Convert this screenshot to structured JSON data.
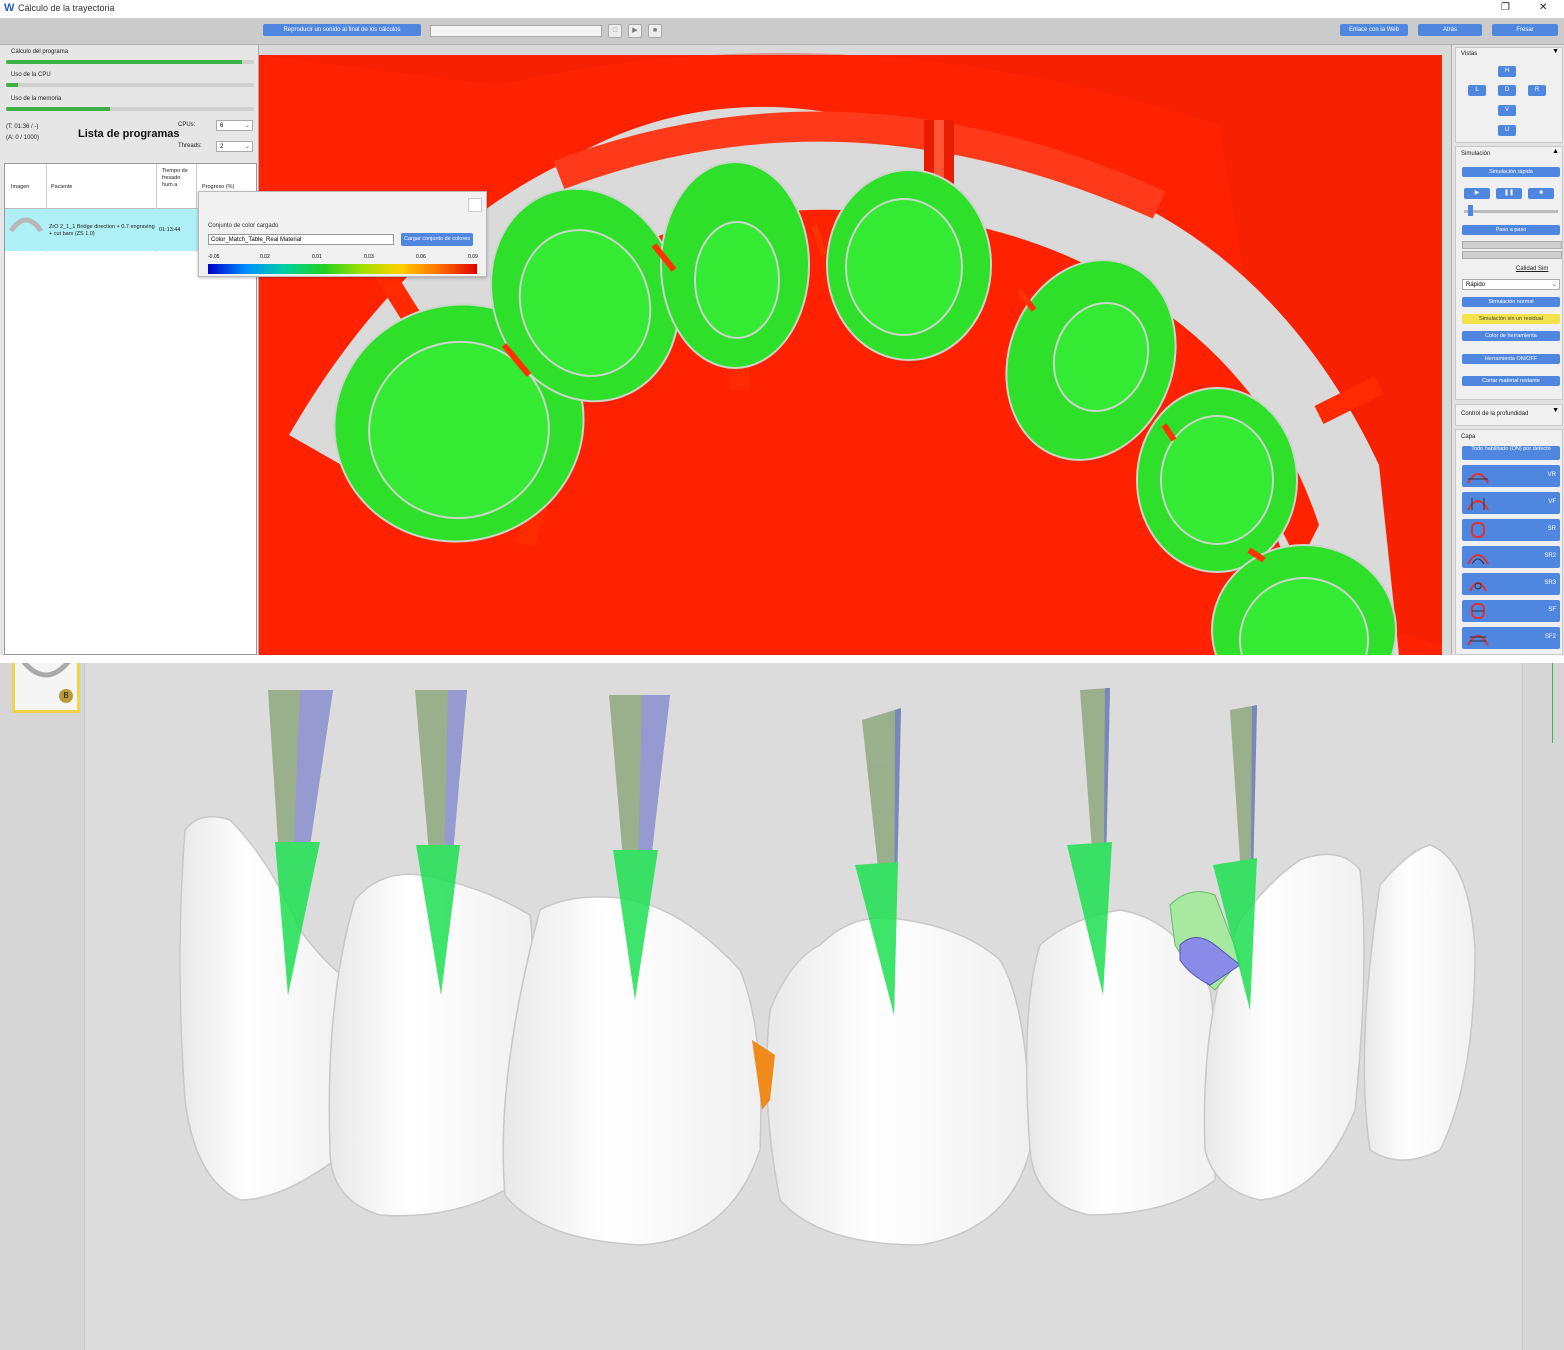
{
  "window": {
    "logo": "W",
    "title": "Cálculo de la trayectoria",
    "restore_icon": "restore-icon",
    "close_icon": "close-icon"
  },
  "toolbar": {
    "sound_button": "Reproducir un sonido al final de los cálculos",
    "web_link": "Enlace con la Web",
    "back": "Atrás",
    "mill": "Fresar"
  },
  "left": {
    "program_calc_label": "Cálculo del programa",
    "cpu_usage_label": "Uso de la CPU",
    "memory_usage_label": "Uso de la memoria",
    "progress_program": 0.95,
    "progress_cpu": 0.05,
    "progress_memory": 0.42,
    "time_info": "(T: 01:36 / -)",
    "count_info": "(A: 0 / 1000)",
    "list_title": "Lista de programas",
    "cpus_label": "CPUs:",
    "cpus_value": "6",
    "threads_label": "Threads:",
    "threads_value": "2",
    "table": {
      "headers": [
        "Imagen",
        "Paciente",
        "Tiempo de fresado hum.a",
        "Progreso (%)"
      ],
      "rows": [
        {
          "patient": "ZrO 2_1_1 Bridge direction + 0.7 engraving + cut bars (ZS 1.0)",
          "time": "01:13:44"
        }
      ]
    }
  },
  "popup": {
    "label": "Conjunto de color cargado",
    "value": "Color_Match_Table_Real Material",
    "load_button": "Cargar conjunto de colores",
    "scale_ticks": [
      "-0.05",
      "0.02",
      "0.01",
      "0.03",
      "0.06",
      "0.09"
    ]
  },
  "right": {
    "views_title": "Vistas",
    "view_buttons": [
      "H",
      "L",
      "D",
      "R",
      "V",
      "U"
    ],
    "simulation_title": "Simulación",
    "fast_sim": "Simulación rápida",
    "step_by_step": "Paso a paso",
    "quality_label": "Calidad Sim",
    "quality_value": "Rápido",
    "normal_sim": "Simulación normal",
    "residual_sim": "Simulación sin un residual",
    "tool_color": "Color de herramienta",
    "tool_toggle": "Herramienta ON/OFF",
    "cut_residual": "Cortar material restante",
    "depth_title": "Control de la profundidad",
    "layer_title": "Capa",
    "all_enabled": "Todo habilitado (ON) por defecto",
    "layers": [
      "VR",
      "VF",
      "SR",
      "SR2",
      "SR3",
      "SF",
      "SF2"
    ]
  },
  "bottom": {
    "badge": "B"
  },
  "colors": {
    "accent_blue": "#4f86e0",
    "stock_red": "#ff2200",
    "tooth_green": "#2ee02a",
    "bar_green": "#3cb043"
  }
}
